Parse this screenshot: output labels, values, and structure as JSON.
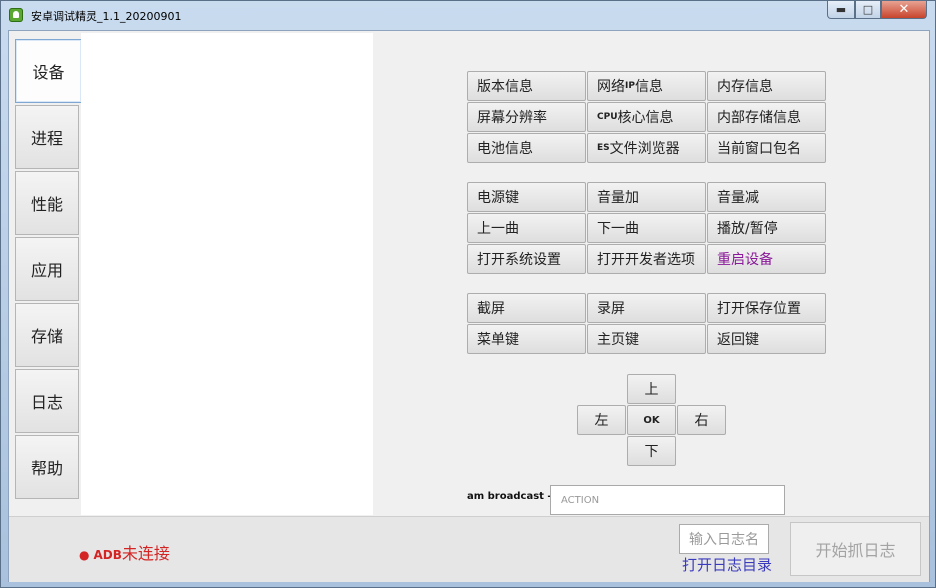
{
  "window": {
    "title": "安卓调试精灵_1.1_20200901",
    "min": "▬",
    "max": "□",
    "close": "✕"
  },
  "sidebar": {
    "items": [
      {
        "label": "设备"
      },
      {
        "label": "进程"
      },
      {
        "label": "性能"
      },
      {
        "label": "应用"
      },
      {
        "label": "存储"
      },
      {
        "label": "日志"
      },
      {
        "label": "帮助"
      }
    ]
  },
  "info_buttons": [
    {
      "label": "版本信息"
    },
    {
      "pre": "网络",
      "small": "IP",
      "post": "信息"
    },
    {
      "label": "内存信息"
    },
    {
      "label": "屏幕分辨率"
    },
    {
      "small": "CPU",
      "post": "核心信息"
    },
    {
      "label": "内部存储信息"
    },
    {
      "label": "电池信息"
    },
    {
      "small": "ES",
      "post": "文件浏览器"
    },
    {
      "label": "当前窗口包名"
    }
  ],
  "key_buttons": [
    {
      "label": "电源键"
    },
    {
      "label": "音量加"
    },
    {
      "label": "音量减"
    },
    {
      "label": "上一曲"
    },
    {
      "label": "下一曲"
    },
    {
      "label": "播放/暂停"
    },
    {
      "label": "打开系统设置"
    },
    {
      "label": "打开开发者选项"
    },
    {
      "label": "重启设备"
    }
  ],
  "screen_buttons": [
    {
      "label": "截屏"
    },
    {
      "label": "录屏"
    },
    {
      "label": "打开保存位置"
    },
    {
      "label": "菜单键"
    },
    {
      "label": "主页键"
    },
    {
      "label": "返回键"
    }
  ],
  "dpad": {
    "up": "上",
    "left": "左",
    "ok": "OK",
    "right": "右",
    "down": "下"
  },
  "broadcast": {
    "label": "am broadcast -a",
    "placeholder": "ACTION"
  },
  "status": {
    "dot": "●",
    "adb": "ADB",
    "text": "未连接"
  },
  "log": {
    "name_placeholder": "输入日志名",
    "open_dir": "打开日志目录",
    "start": "开始抓日志"
  },
  "colors": {
    "danger": "#d42525",
    "link": "#3b3bbd",
    "purple": "#8a1a99"
  }
}
